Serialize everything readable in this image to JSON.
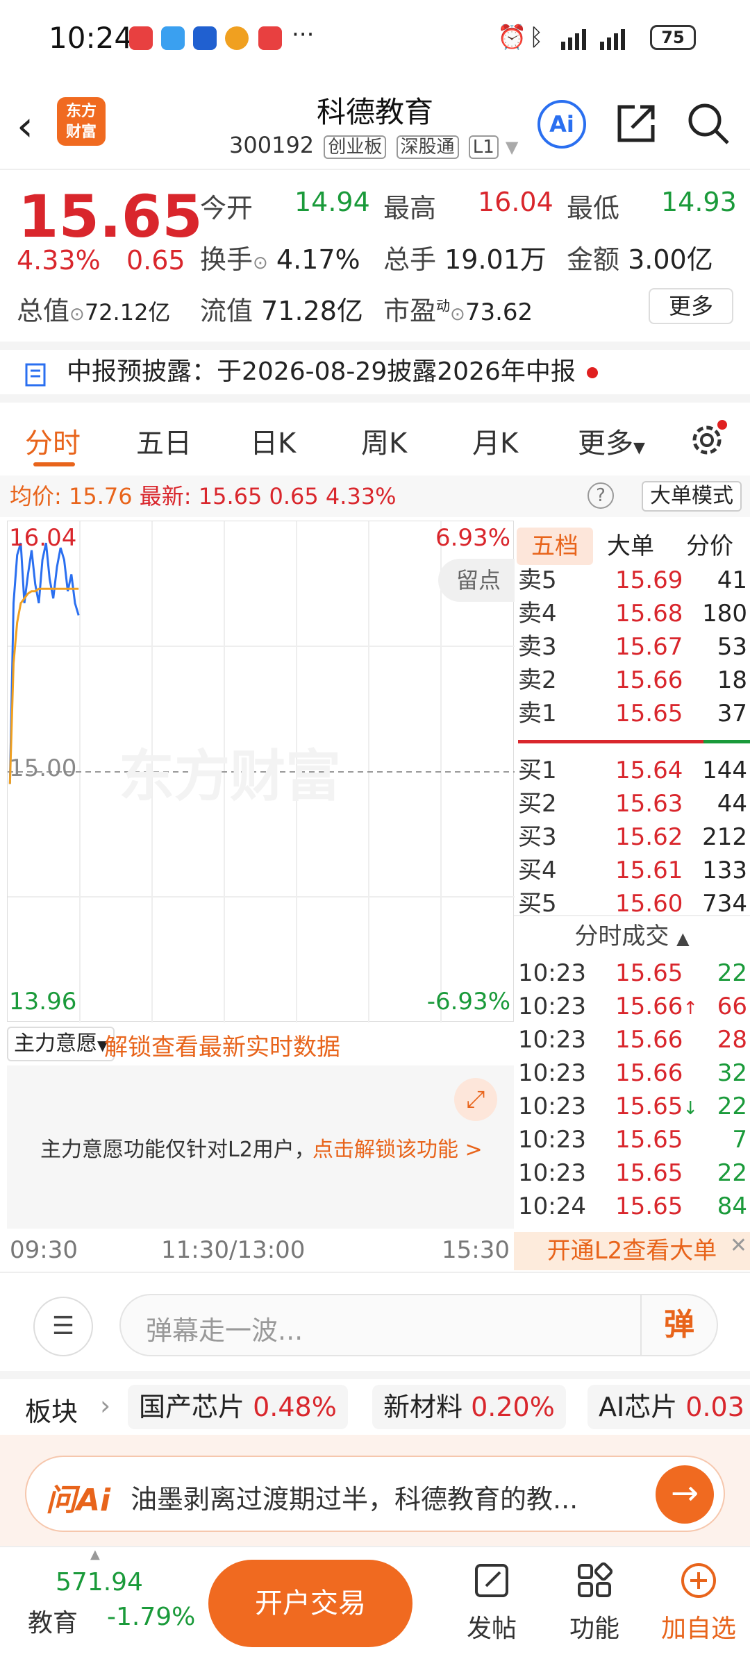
{
  "status": {
    "time": "10:24",
    "more": "···",
    "battery": "75"
  },
  "header": {
    "back": "‹",
    "logo_line1": "东方",
    "logo_line2": "财富",
    "title": "科德教育",
    "code": "300192",
    "tags": [
      "创业板",
      "深股通",
      "L1"
    ],
    "ai": "Ai"
  },
  "quote": {
    "price": "15.65",
    "pct": "4.33%",
    "change": "0.65",
    "open_label": "今开",
    "open": "14.94",
    "high_label": "最高",
    "high": "16.04",
    "low_label": "最低",
    "low": "14.93",
    "turnover_label": "换手",
    "turnover": "4.17%",
    "volume_label": "总手",
    "volume": "19.01万",
    "amount_label": "金额",
    "amount": "3.00亿",
    "mktcap_label": "总值",
    "mktcap": "72.12亿",
    "float_label": "流值",
    "float": "71.28亿",
    "pe_label": "市盈",
    "pe_sup": "动",
    "pe": "73.62",
    "more": "更多"
  },
  "notice": {
    "label": "中报预披露：",
    "text": "于2026-08-29披露2026年中报"
  },
  "tabs": [
    "分时",
    "五日",
    "日K",
    "周K",
    "月K",
    "更多"
  ],
  "info": {
    "avg_label": "均价:",
    "avg": "15.76",
    "latest_label": "最新:",
    "latest": "15.65",
    "change": "0.65",
    "pct": "4.33%",
    "mode": "大单模式",
    "help": "?"
  },
  "chart": {
    "top_price": "16.04",
    "top_pct": "6.93%",
    "mid_price": "15.00",
    "bottom_price": "13.96",
    "bottom_pct": "-6.93%",
    "watermark": "东方财富",
    "liudian": "留点"
  },
  "chart_data": {
    "type": "line",
    "series": [
      {
        "name": "最新",
        "values": [
          14.95,
          15.7,
          15.9,
          15.95,
          15.7,
          15.82,
          15.92,
          15.78,
          15.7,
          15.88,
          15.95,
          15.8,
          15.72,
          15.85,
          15.93,
          15.88,
          15.75,
          15.82,
          15.7,
          15.65
        ]
      },
      {
        "name": "均价",
        "values": [
          14.95,
          15.45,
          15.62,
          15.7,
          15.72,
          15.74,
          15.75,
          15.75,
          15.76,
          15.76,
          15.76,
          15.76,
          15.76,
          15.76,
          15.76,
          15.76,
          15.76,
          15.76,
          15.76,
          15.76
        ]
      }
    ],
    "ylim": [
      13.96,
      16.04
    ],
    "x": [
      "09:30",
      "11:30/13:00",
      "15:30"
    ]
  },
  "book": {
    "tabs": [
      "五档",
      "大单",
      "分价"
    ],
    "asks": [
      {
        "n": "卖5",
        "p": "15.69",
        "v": "41"
      },
      {
        "n": "卖4",
        "p": "15.68",
        "v": "180"
      },
      {
        "n": "卖3",
        "p": "15.67",
        "v": "53"
      },
      {
        "n": "卖2",
        "p": "15.66",
        "v": "18"
      },
      {
        "n": "卖1",
        "p": "15.65",
        "v": "37"
      }
    ],
    "bids": [
      {
        "n": "买1",
        "p": "15.64",
        "v": "144"
      },
      {
        "n": "买2",
        "p": "15.63",
        "v": "44"
      },
      {
        "n": "买3",
        "p": "15.62",
        "v": "212"
      },
      {
        "n": "买4",
        "p": "15.61",
        "v": "133"
      },
      {
        "n": "买5",
        "p": "15.60",
        "v": "734"
      }
    ],
    "trades_title": "分时成交",
    "trades": [
      {
        "t": "10:23",
        "p": "15.65",
        "a": "",
        "v": "22"
      },
      {
        "t": "10:23",
        "p": "15.66",
        "a": "↑",
        "v": "66"
      },
      {
        "t": "10:23",
        "p": "15.66",
        "a": "",
        "v": "28"
      },
      {
        "t": "10:23",
        "p": "15.66",
        "a": "",
        "v": "32"
      },
      {
        "t": "10:23",
        "p": "15.65",
        "a": "↓",
        "v": "22"
      },
      {
        "t": "10:23",
        "p": "15.65",
        "a": "",
        "v": "7"
      },
      {
        "t": "10:23",
        "p": "15.65",
        "a": "",
        "v": "22"
      },
      {
        "t": "10:24",
        "p": "15.65",
        "a": "",
        "v": "84"
      }
    ]
  },
  "zhuli": {
    "selector": "主力意愿",
    "unlock": "解锁查看最新实时数据",
    "desc": "主力意愿功能仅针对L2用户，",
    "link": "点击解锁该功能 >"
  },
  "timeaxis": {
    "start": "09:30",
    "mid": "11:30/13:00",
    "end": "15:30"
  },
  "l2": "开通L2查看大单",
  "comment": {
    "placeholder": "弹幕走一波...",
    "danmu": "弹"
  },
  "sectors": {
    "label": "板块",
    "items": [
      {
        "name": "国产芯片",
        "pct": "0.48%"
      },
      {
        "name": "新材料",
        "pct": "0.20%"
      },
      {
        "name": "AI芯片",
        "pct": "0.03"
      }
    ]
  },
  "askai": {
    "logo": "问Ai",
    "text": "油墨剥离过渡期过半，科德教育的教..."
  },
  "bottom": {
    "index_value": "571.94",
    "index_name": "教育",
    "index_pct": "-1.79%",
    "trade": "开户交易",
    "post": "发帖",
    "func": "功能",
    "add": "加自选"
  }
}
